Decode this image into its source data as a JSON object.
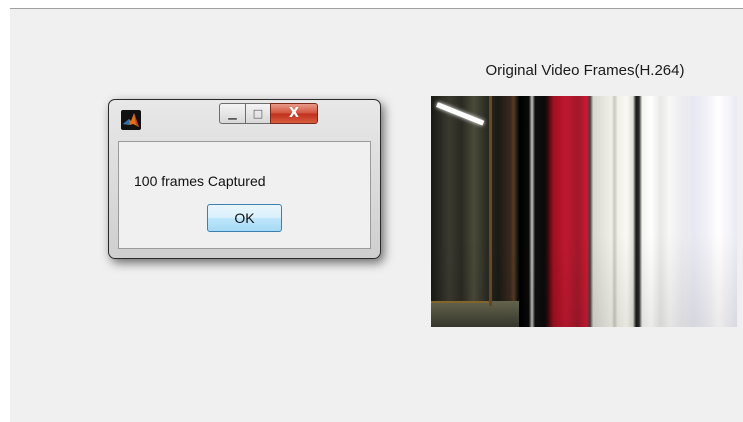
{
  "figure": {
    "axes_title": "Original Video Frames(H.264)"
  },
  "dialog": {
    "app_icon": "matlab-icon",
    "caption_buttons": {
      "minimize_glyph": "▁",
      "maximize_glyph": "□",
      "close_glyph": "X"
    },
    "message": "100 frames Captured",
    "ok_label": "OK"
  }
}
